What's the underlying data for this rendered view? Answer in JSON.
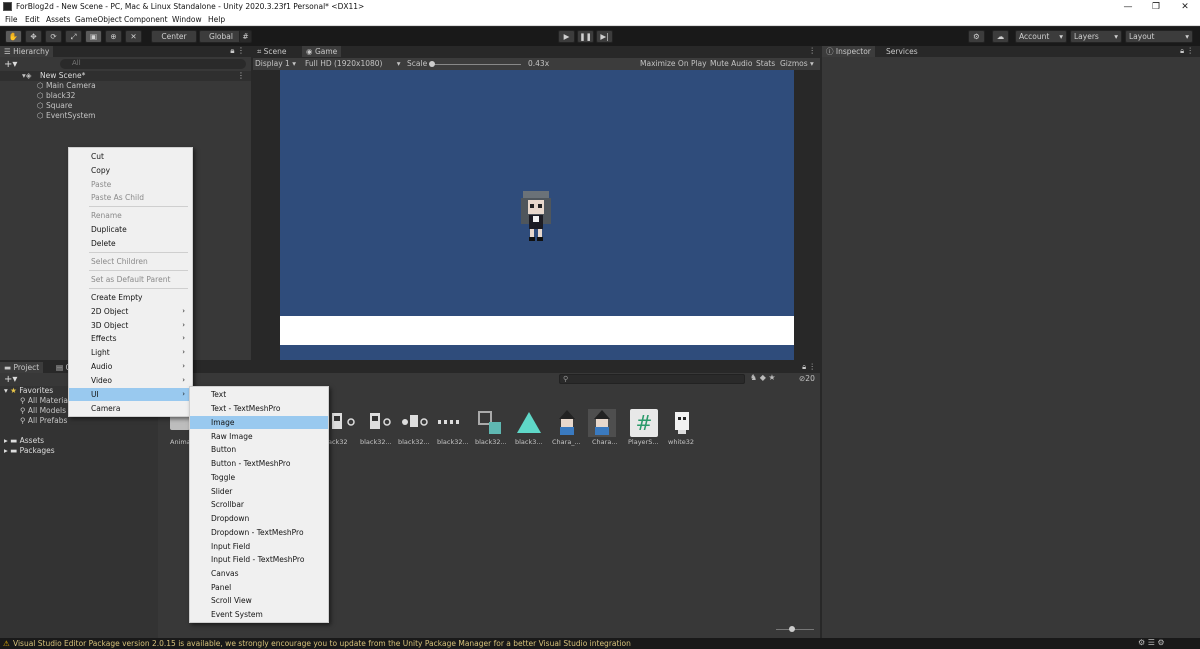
{
  "window": {
    "title": "ForBlog2d - New Scene - PC, Mac & Linux Standalone - Unity 2020.3.23f1 Personal* <DX11>",
    "controls": [
      "—",
      "❐",
      "✕"
    ]
  },
  "menubar": [
    "File",
    "Edit",
    "Assets",
    "GameObject",
    "Component",
    "Window",
    "Help"
  ],
  "toolbar": {
    "pivot": "Center",
    "space": "Global",
    "account": "Account",
    "layers": "Layers",
    "layout": "Layout"
  },
  "hierarchy": {
    "tab": "Hierarchy",
    "search_placeholder": "All",
    "scene": "New Scene*",
    "items": [
      "Main Camera",
      "black32",
      "Square",
      "EventSystem"
    ]
  },
  "game_view": {
    "tabs": [
      "Scene",
      "Game"
    ],
    "display": "Display 1",
    "resolution": "Full HD (1920x1080)",
    "scale_label": "Scale",
    "scale_value": "0.43x",
    "buttons": [
      "Maximize On Play",
      "Mute Audio",
      "Stats",
      "Gizmos"
    ],
    "bg_color": "#2f4c7b"
  },
  "inspector": {
    "tab": "Inspector",
    "services": "Services"
  },
  "project": {
    "tab": "Project",
    "favorites_label": "Favorites",
    "favorites": [
      "All Materials",
      "All Models",
      "All Prefabs"
    ],
    "folders": [
      "Assets",
      "Packages"
    ],
    "count": "20",
    "assets": [
      {
        "label": "Anima",
        "icon": "folder-icon"
      },
      {
        "label": "ack32",
        "icon": "sprite-icon"
      },
      {
        "label": "black32...",
        "icon": "sprite-icon"
      },
      {
        "label": "black32...",
        "icon": "sprite-icon"
      },
      {
        "label": "black32...",
        "icon": "sprite-icon"
      },
      {
        "label": "black32...",
        "icon": "sprite-icon"
      },
      {
        "label": "black3...",
        "icon": "triangle-icon"
      },
      {
        "label": "Chara_...",
        "icon": "character-icon"
      },
      {
        "label": "Chara...",
        "icon": "character-icon"
      },
      {
        "label": "PlayerS...",
        "icon": "script-icon"
      },
      {
        "label": "white32",
        "icon": "sprite-icon"
      }
    ]
  },
  "context_menu": {
    "items": [
      {
        "label": "Cut",
        "disabled": false
      },
      {
        "label": "Copy",
        "disabled": false
      },
      {
        "label": "Paste",
        "disabled": true
      },
      {
        "label": "Paste As Child",
        "disabled": true
      },
      {
        "label": "Rename",
        "disabled": true
      },
      {
        "label": "Duplicate",
        "disabled": false
      },
      {
        "label": "Delete",
        "disabled": false
      },
      {
        "label": "Select Children",
        "disabled": true
      },
      {
        "label": "Set as Default Parent",
        "disabled": true
      },
      {
        "label": "Create Empty",
        "disabled": false
      },
      {
        "label": "2D Object",
        "disabled": false,
        "submenu": true
      },
      {
        "label": "3D Object",
        "disabled": false,
        "submenu": true
      },
      {
        "label": "Effects",
        "disabled": false,
        "submenu": true
      },
      {
        "label": "Light",
        "disabled": false,
        "submenu": true
      },
      {
        "label": "Audio",
        "disabled": false,
        "submenu": true
      },
      {
        "label": "Video",
        "disabled": false,
        "submenu": true
      },
      {
        "label": "UI",
        "disabled": false,
        "submenu": true,
        "highlighted": true
      },
      {
        "label": "Camera",
        "disabled": false
      }
    ]
  },
  "ui_submenu": {
    "items": [
      "Text",
      "Text - TextMeshPro",
      "Image",
      "Raw Image",
      "Button",
      "Button - TextMeshPro",
      "Toggle",
      "Slider",
      "Scrollbar",
      "Dropdown",
      "Dropdown - TextMeshPro",
      "Input Field",
      "Input Field - TextMeshPro",
      "Canvas",
      "Panel",
      "Scroll View",
      "Event System"
    ],
    "highlighted": "Image"
  },
  "status": {
    "message": "Visual Studio Editor Package version 2.0.15 is available, we strongly encourage you to update from the Unity Package Manager for a better Visual Studio integration"
  }
}
